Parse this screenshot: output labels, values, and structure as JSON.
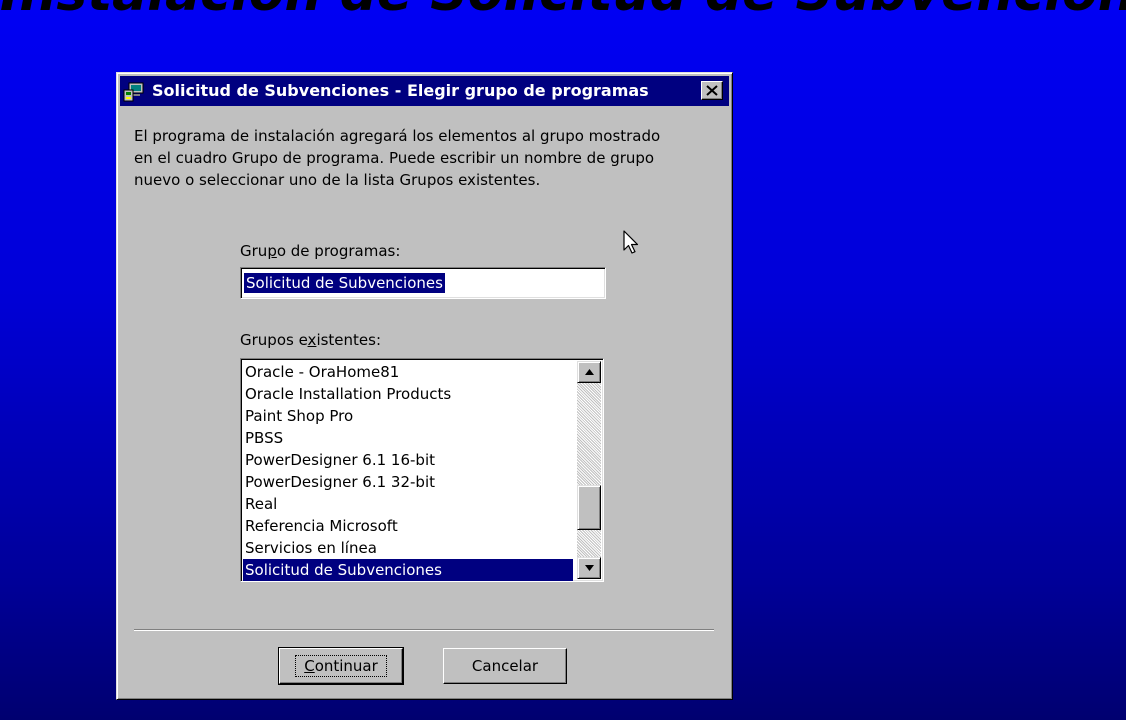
{
  "banner": {
    "title": "Instalación de Solicitud de Subvenciones"
  },
  "dialog": {
    "title": "Solicitud de Subvenciones - Elegir grupo de programas",
    "description": [
      "El programa de instalación agregará los elementos al grupo mostrado",
      "en el cuadro Grupo de programa. Puede escribir un nombre de grupo",
      "nuevo o seleccionar uno de la lista Grupos existentes."
    ],
    "program_group": {
      "label_pre": "Gru",
      "label_hotkey": "p",
      "label_post": "o de programas:",
      "value": "Solicitud de Subvenciones"
    },
    "existing_groups": {
      "label_pre": "Grupos e",
      "label_hotkey": "x",
      "label_post": "istentes:",
      "items": [
        "Oracle - OraHome81",
        "Oracle Installation Products",
        "Paint Shop Pro",
        "PBSS",
        "PowerDesigner 6.1 16-bit",
        "PowerDesigner 6.1 32-bit",
        "Real",
        "Referencia Microsoft",
        "Servicios en línea",
        "Solicitud de Subvenciones"
      ],
      "selected_index": 9
    },
    "buttons": {
      "continue_hotkey": "C",
      "continue_rest": "ontinuar",
      "cancel": "Cancelar"
    }
  },
  "icons": {
    "app": "setup-computer-icon",
    "close": "close-x-icon",
    "scroll_up": "triangle-up-icon",
    "scroll_down": "triangle-down-icon",
    "cursor": "mouse-pointer-icon"
  },
  "colors": {
    "desktop_top": "#0000f4",
    "desktop_bottom": "#000070",
    "titlebar": "#000080",
    "face": "#c0c0c0",
    "selection": "#000080"
  }
}
